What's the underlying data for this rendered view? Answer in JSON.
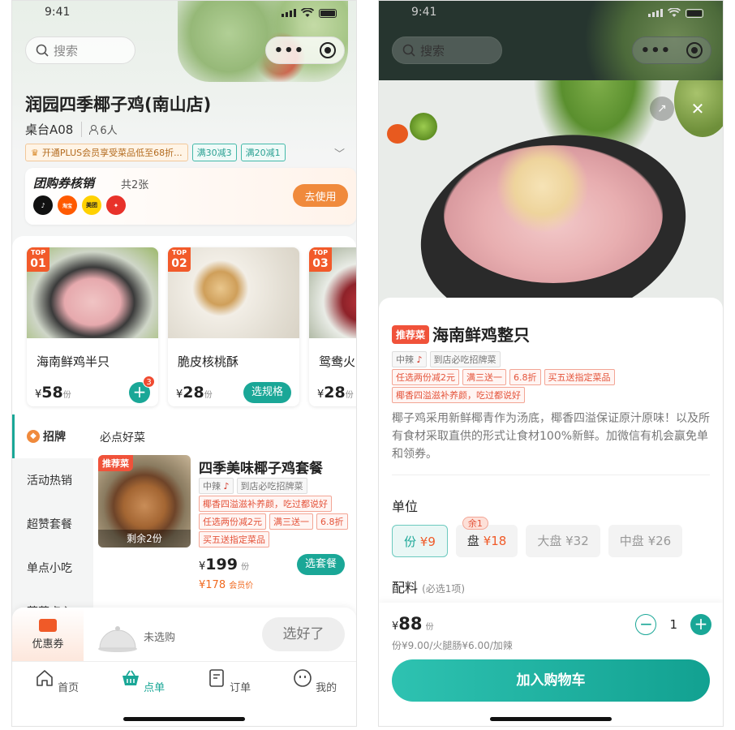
{
  "left": {
    "status_time": "9:41",
    "search_placeholder": "搜索",
    "shop_name": "润园四季椰子鸡(南山店)",
    "table": "桌台A08",
    "people": "6人",
    "plus_promo": "开通PLUS会员享受菜品低至68折...",
    "discount_tags": [
      "满30减3",
      "满20减1"
    ],
    "groupon": {
      "title": "团购券核销",
      "count": "共2张",
      "button": "去使用",
      "platforms": [
        "抖音",
        "淘宝闪购",
        "美团",
        "饿了么"
      ]
    },
    "top_cards": [
      {
        "rank_label": "TOP",
        "rank": "01",
        "name": "海南鲜鸡半只",
        "price": "58",
        "unit": "份",
        "cart_count": "3",
        "action": "+"
      },
      {
        "rank_label": "TOP",
        "rank": "02",
        "name": "脆皮核桃酥",
        "price": "28",
        "unit": "份",
        "action": "选规格"
      },
      {
        "rank_label": "TOP",
        "rank": "03",
        "name": "鸳鸯火",
        "price": "28",
        "unit": "份"
      }
    ],
    "currency": "¥",
    "sidebar": [
      "招牌",
      "活动热销",
      "超赞套餐",
      "单点小吃",
      "蔬菜点心"
    ],
    "section_title": "必点好菜",
    "combo": {
      "badge": "推荐菜",
      "remain": "剩余2份",
      "name": "四季美味椰子鸡套餐",
      "spice": "中辣",
      "tag_store": "到店必吃招牌菜",
      "tag_desc": "椰香四溢滋补养颜，吃过都说好",
      "tags_promo": [
        "任选两份减2元",
        "满三送一",
        "6.8折"
      ],
      "tag_gift": "买五送指定菜品",
      "price": "199",
      "unit": "份",
      "member_price": "¥178",
      "member_label": "会员价",
      "button": "选套餐"
    },
    "cart": {
      "coupon": "优惠券",
      "empty": "未选购",
      "done": "选好了"
    },
    "tabs": [
      "首页",
      "点单",
      "订单",
      "我的"
    ]
  },
  "right": {
    "status_time": "9:41",
    "search_placeholder": "搜索",
    "badge": "推荐菜",
    "dish_name": "海南鲜鸡整只",
    "spice": "中辣",
    "tag_store": "到店必吃招牌菜",
    "tags_promo": [
      "任选两份减2元",
      "满三送一",
      "6.8折",
      "买五送指定菜品"
    ],
    "tag_desc": "椰香四溢滋补养颜，吃过都说好",
    "description": "椰子鸡采用新鲜椰青作为汤底，椰香四溢保证原汁原味！以及所有食材采取直供的形式让食材100%新鲜。加微信有机会赢免单和领券。",
    "unit_label": "单位",
    "units": [
      {
        "name": "份",
        "price": "¥9",
        "state": "selected"
      },
      {
        "name": "盘",
        "price": "¥18",
        "tip": "余1",
        "state": "normal"
      },
      {
        "name": "大盘",
        "price": "¥32",
        "state": "disabled"
      },
      {
        "name": "中盘",
        "price": "¥26",
        "state": "disabled"
      }
    ],
    "extras_label": "配料",
    "extras_hint": "(必选1项)",
    "total_price": "88",
    "total_unit": "份",
    "summary": "份¥9.00/火腿肠¥6.00/加辣",
    "quantity": "1",
    "add_cart": "加入购物车"
  },
  "colors": {
    "primary": "#1aa797",
    "accent": "#f05a28",
    "recommend": "#f0523a"
  }
}
